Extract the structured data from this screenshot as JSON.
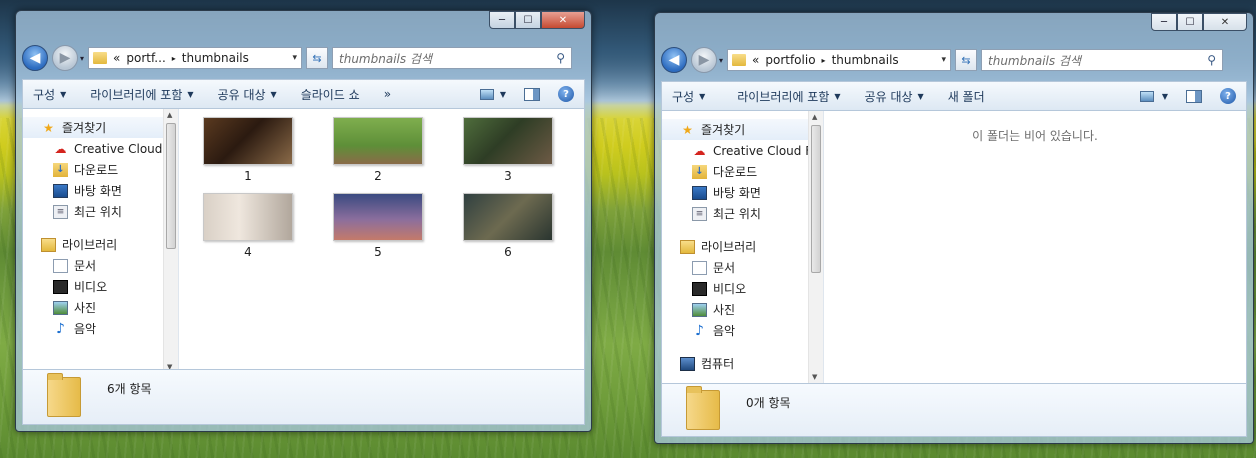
{
  "left_window": {
    "address": {
      "overflow": "«",
      "crumb1": "portf...",
      "sep": "▸",
      "crumb2": "thumbnails"
    },
    "search_placeholder": "thumbnails 검색",
    "toolbar": {
      "organize": "구성",
      "include_library": "라이브러리에 포함",
      "share_with": "공유 대상",
      "slideshow": "슬라이드 쇼",
      "more": "»"
    },
    "nav": {
      "favorites": "즐겨찾기",
      "creative_cloud": "Creative Cloud F",
      "downloads": "다운로드",
      "desktop": "바탕 화면",
      "recent": "최근 위치",
      "libraries": "라이브러리",
      "documents": "문서",
      "videos": "비디오",
      "pictures": "사진",
      "music": "음악"
    },
    "files": [
      {
        "name": "1",
        "subject": "camera"
      },
      {
        "name": "2",
        "subject": "rabbits"
      },
      {
        "name": "3",
        "subject": "backpack"
      },
      {
        "name": "4",
        "subject": "flip-clock"
      },
      {
        "name": "5",
        "subject": "tower-bridge"
      },
      {
        "name": "6",
        "subject": "otter"
      }
    ],
    "status": "6개 항목"
  },
  "right_window": {
    "address": {
      "overflow": "«",
      "crumb1": "portfolio",
      "sep": "▸",
      "crumb2": "thumbnails"
    },
    "search_placeholder": "thumbnails 검색",
    "toolbar": {
      "organize": "구성",
      "include_library": "라이브러리에 포함",
      "share_with": "공유 대상",
      "new_folder": "새 폴더"
    },
    "nav": {
      "favorites": "즐겨찾기",
      "creative_cloud": "Creative Cloud F",
      "downloads": "다운로드",
      "desktop": "바탕 화면",
      "recent": "최근 위치",
      "libraries": "라이브러리",
      "documents": "문서",
      "videos": "비디오",
      "pictures": "사진",
      "music": "음악",
      "computer": "컴퓨터"
    },
    "empty_message": "이 폴더는 비어 있습니다.",
    "status": "0개 항목"
  },
  "caption": {
    "minimize": "─",
    "maximize": "☐",
    "close": "✕"
  },
  "colors": {
    "accent": "#1e395b",
    "selection": "#e4eef9"
  }
}
